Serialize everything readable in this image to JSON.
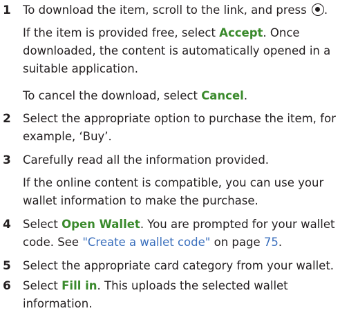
{
  "steps": [
    {
      "number": "1",
      "line1": "To download the item, scroll to the link, and press",
      "icon": "joystick-press-icon",
      "dot": ".",
      "p2_before": "If the item is provided free, select ",
      "p2_ui": "Accept",
      "p2_after": ". Once downloaded, the content is automatically opened in a suitable application.",
      "p3_before": "To cancel the download, select ",
      "p3_ui": "Cancel",
      "p3_after": "."
    },
    {
      "number": "2",
      "text": "Select the appropriate option to purchase the item, for example, ‘Buy’."
    },
    {
      "number": "3",
      "text": "Carefully read all the information provided.",
      "note": "If the online content is compatible, you can use your wallet information to make the purchase."
    },
    {
      "number": "4",
      "before": "Select ",
      "ui": "Open Wallet",
      "middle": ". You are prompted for your wallet code. See ",
      "link": "\"Create a wallet code\"",
      "on_page": " on page ",
      "page": "75",
      "end": "."
    },
    {
      "number": "5",
      "text": "Select the appropriate card category from your wallet."
    },
    {
      "number": "6",
      "before": "Select ",
      "ui": "Fill in",
      "after": ". This uploads the selected wallet information."
    }
  ],
  "colors": {
    "text": "#231f20",
    "ui_term": "#3a8a2c",
    "link": "#3a6fbd"
  }
}
